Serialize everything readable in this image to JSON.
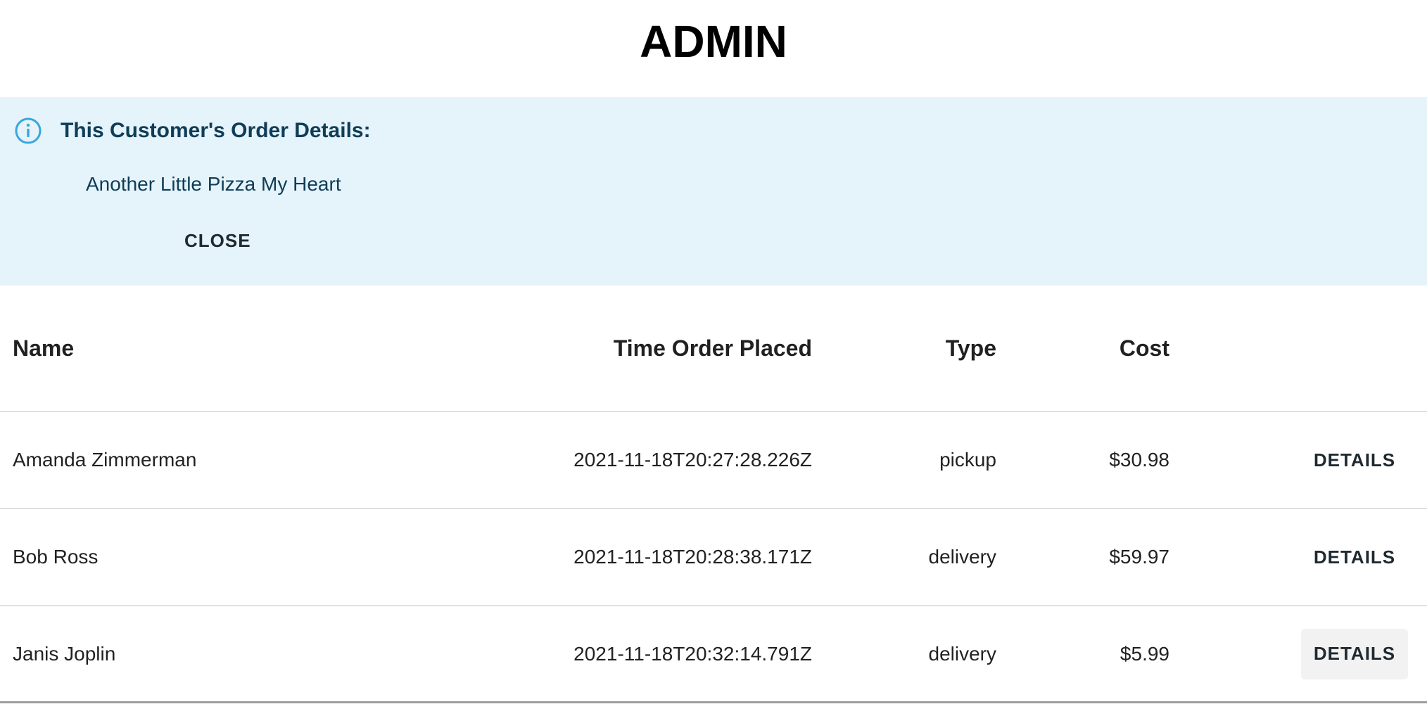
{
  "page": {
    "title": "ADMIN"
  },
  "alert": {
    "icon": "info-icon",
    "title": "This Customer's Order Details:",
    "body": "Another Little Pizza My Heart",
    "close_label": "CLOSE",
    "colors": {
      "background": "#e5f3fa",
      "text": "#0f3d57",
      "icon": "#3aa5dd"
    }
  },
  "table": {
    "headers": {
      "name": "Name",
      "time": "Time Order Placed",
      "type": "Type",
      "cost": "Cost"
    },
    "rows": [
      {
        "name": "Amanda Zimmerman",
        "time": "2021-11-18T20:27:28.226Z",
        "type": "pickup",
        "cost": "$30.98",
        "action": "DETAILS"
      },
      {
        "name": "Bob Ross",
        "time": "2021-11-18T20:28:38.171Z",
        "type": "delivery",
        "cost": "$59.97",
        "action": "DETAILS"
      },
      {
        "name": "Janis Joplin",
        "time": "2021-11-18T20:32:14.791Z",
        "type": "delivery",
        "cost": "$5.99",
        "action": "DETAILS"
      }
    ]
  }
}
